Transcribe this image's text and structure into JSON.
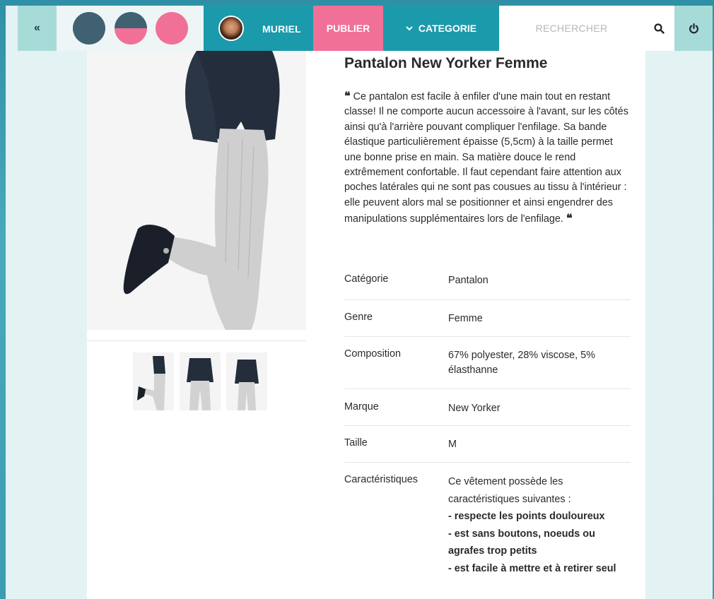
{
  "nav": {
    "collapse_label": "«",
    "swatches": [
      {
        "name": "dark-blue",
        "colors": [
          "#3f6172"
        ]
      },
      {
        "name": "dark-blue-pink",
        "colors": [
          "#3f6172",
          "#f07098"
        ]
      },
      {
        "name": "pink",
        "colors": [
          "#f07098"
        ]
      }
    ],
    "user_name": "MURIEL",
    "publish_label": "PUBLIER",
    "category_label": "CATEGORIE",
    "category_icon": "chevron-down-icon",
    "search_placeholder": "RECHERCHER",
    "search_value": "",
    "search_icon": "search-icon",
    "power_icon": "power-icon",
    "colors": {
      "teal": "#1b9aab",
      "pink": "#f07098",
      "mint": "#a6dbd8",
      "light_bg": "#e3f2f3"
    }
  },
  "product": {
    "title": "Pantalon New Yorker Femme",
    "description": "Ce pantalon est facile à enfiler d'une main tout en restant classe! Il ne comporte aucun accessoire à l'avant, sur les côtés ainsi qu'à l'arrière pouvant compliquer l'enfilage. Sa bande élastique particulièrement épaisse (5,5cm) à la taille permet une bonne prise en main. Sa matière douce le rend extrêmement confortable. Il faut cependant faire attention aux poches latérales qui ne sont pas cousues au tissu à l'intérieur : elle peuvent alors mal se positionner et ainsi engendrer des manipulations supplémentaires lors de l'enfilage.",
    "quote_open": "❝",
    "quote_close": "❝",
    "thumbnails": [
      "thumb-side-pose",
      "thumb-back-view",
      "thumb-front-view"
    ],
    "specs": [
      {
        "label": "Catégorie",
        "value": "Pantalon"
      },
      {
        "label": "Genre",
        "value": "Femme"
      },
      {
        "label": "Composition",
        "value": "67% polyester, 28% viscose, 5% élasthanne"
      },
      {
        "label": "Marque",
        "value": "New Yorker"
      },
      {
        "label": "Taille",
        "value": "M"
      }
    ],
    "characteristics": {
      "label": "Caractéristiques",
      "intro": "Ce vêtement possède les caractéristiques suivantes :",
      "items": [
        "- respecte les points douloureux",
        "- est sans boutons, noeuds ou agrafes trop petits",
        "- est facile à mettre et à retirer seul"
      ]
    }
  }
}
